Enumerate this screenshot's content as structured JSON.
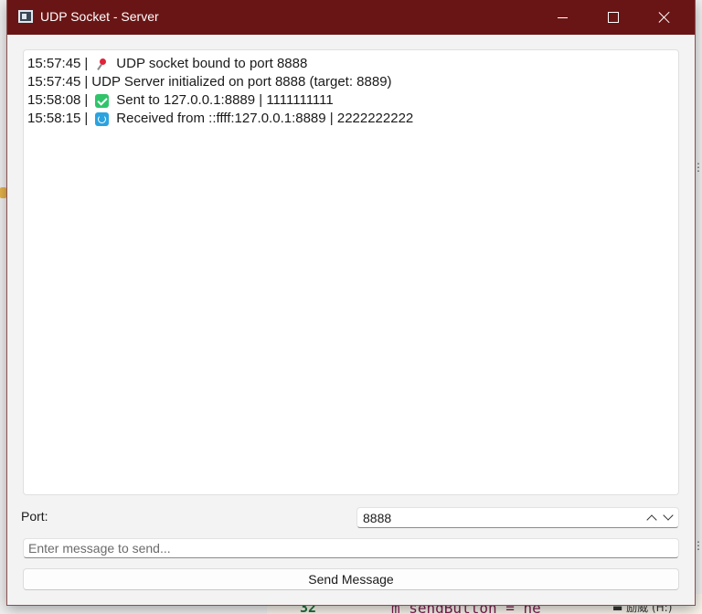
{
  "window": {
    "title": "UDP Socket - Server"
  },
  "log": {
    "entries": [
      {
        "time": "15:57:45",
        "icon": "pushpin-icon",
        "text": "UDP socket bound to port 8888"
      },
      {
        "time": "15:57:45",
        "icon": "",
        "text": "UDP Server initialized on port 8888 (target: 8889)"
      },
      {
        "time": "15:58:08",
        "icon": "check-mark-icon",
        "text": "Sent to 127.0.0.1:8889 | 1111111111"
      },
      {
        "time": "15:58:15",
        "icon": "refresh-icon",
        "text": "Received from ::ffff:127.0.0.1:8889 | 2222222222"
      }
    ],
    "separator": "|"
  },
  "controls": {
    "port_label": "Port:",
    "port_value": "8888",
    "message_placeholder": "Enter message to send...",
    "send_label": "Send Message"
  },
  "background": {
    "line_number": "32",
    "code_fragment": "m_sendButton = ne",
    "side_text": "▬ 励威 (H:)"
  }
}
